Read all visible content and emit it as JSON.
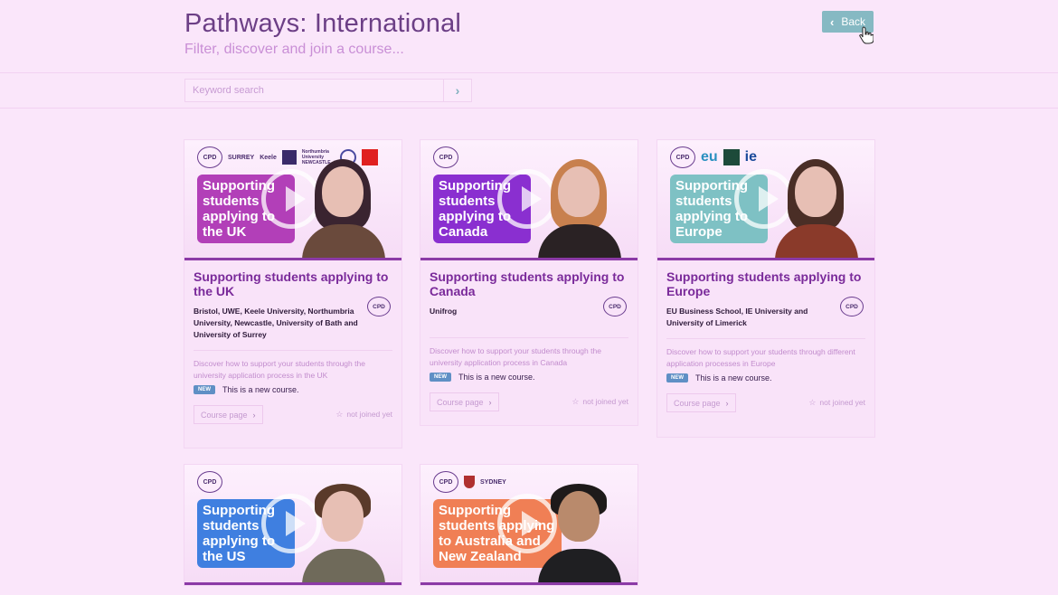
{
  "header": {
    "title": "Pathways: International",
    "subtitle": "Filter, discover and join a course...",
    "back_label": "Back"
  },
  "search": {
    "placeholder": "Keyword search",
    "value": ""
  },
  "icons": {
    "search_button": "chevron-right-icon",
    "back": "chevron-left-icon",
    "cursor": "hand-pointer-icon",
    "status": "star-outline-icon",
    "play": "play-icon"
  },
  "colors": {
    "background": "#fae6fa",
    "back_button": "#86b9c3",
    "uk_banner": "#b23fb8",
    "canada_banner": "#8a2fd0",
    "europe_banner": "#7ec1c4",
    "us_banner": "#3f7fe0",
    "anz_banner": "#f07f55",
    "new_badge": "#5f8fc5"
  },
  "courses": [
    {
      "banner": "Supporting students applying to the UK",
      "logos": [
        "SURREY",
        "Keele",
        "Northumbria University NEWCASTLE"
      ],
      "title": "Supporting students applying to the UK",
      "partners": "Bristol, UWE, Keele University, Northumbria University, Newcastle, University of Bath and University of Surrey",
      "description": "Discover how to support your students through the university application process in the UK",
      "new_badge": "NEW",
      "new_text": "This is a new course.",
      "button": "Course page",
      "status": "not joined yet"
    },
    {
      "banner": "Supporting students applying to Canada",
      "logos": [],
      "title": "Supporting students applying to Canada",
      "partners": "Unifrog",
      "description": "Discover how to support your students through the university application process in Canada",
      "new_badge": "NEW",
      "new_text": "This is a new course.",
      "button": "Course page",
      "status": "not joined yet"
    },
    {
      "banner": "Supporting students applying to Europe",
      "logos": [
        "eu",
        "ie"
      ],
      "title": "Supporting students applying to Europe",
      "partners": "EU Business School, IE University and University of Limerick",
      "description": "Discover how to support your students through different application processes in Europe",
      "new_badge": "NEW",
      "new_text": "This is a new course.",
      "button": "Course page",
      "status": "not joined yet"
    },
    {
      "banner": "Supporting students applying to the US",
      "logos": []
    },
    {
      "banner": "Supporting students applying to Australia and New Zealand",
      "logos": [
        "SYDNEY"
      ]
    }
  ],
  "cpd_mark": "CPD"
}
